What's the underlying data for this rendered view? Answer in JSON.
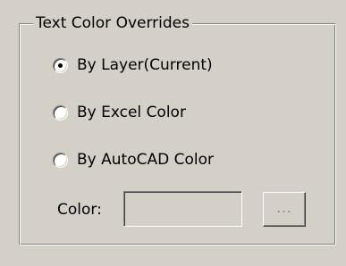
{
  "group": {
    "title": "Text Color Overrides"
  },
  "options": [
    {
      "label": "By Layer(Current)",
      "selected": true
    },
    {
      "label": "By Excel Color",
      "selected": false
    },
    {
      "label": "By AutoCAD Color",
      "selected": false
    }
  ],
  "color": {
    "label": "Color:",
    "value": "",
    "browse_label": "..."
  }
}
